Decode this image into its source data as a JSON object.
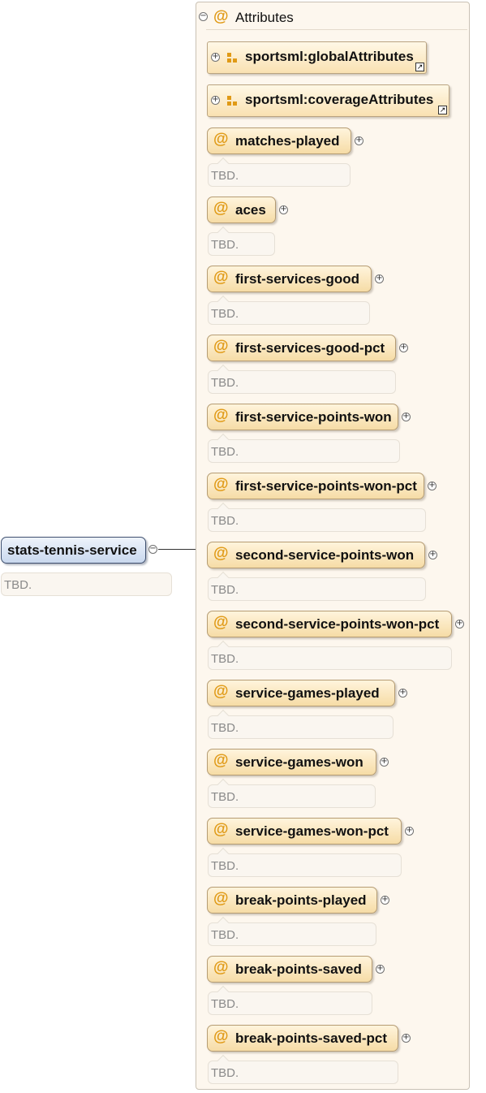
{
  "root": {
    "name": "stats-tennis-service",
    "doc": "TBD."
  },
  "attributes_panel": {
    "title": "Attributes",
    "groups": [
      {
        "label": "sportsml:globalAttributes"
      },
      {
        "label": "sportsml:coverageAttributes"
      }
    ],
    "items": [
      {
        "name": "matches-played",
        "doc": "TBD."
      },
      {
        "name": "aces",
        "doc": "TBD."
      },
      {
        "name": "first-services-good",
        "doc": "TBD."
      },
      {
        "name": "first-services-good-pct",
        "doc": "TBD."
      },
      {
        "name": "first-service-points-won",
        "doc": "TBD."
      },
      {
        "name": "first-service-points-won-pct",
        "doc": "TBD."
      },
      {
        "name": "second-service-points-won",
        "doc": "TBD."
      },
      {
        "name": "second-service-points-won-pct",
        "doc": "TBD."
      },
      {
        "name": "service-games-played",
        "doc": "TBD."
      },
      {
        "name": "service-games-won",
        "doc": "TBD."
      },
      {
        "name": "service-games-won-pct",
        "doc": "TBD."
      },
      {
        "name": "break-points-played",
        "doc": "TBD."
      },
      {
        "name": "break-points-saved",
        "doc": "TBD."
      },
      {
        "name": "break-points-saved-pct",
        "doc": "TBD."
      }
    ]
  },
  "symbols": {
    "attribute_icon": "@",
    "collapse": "−",
    "expand": "+",
    "link": "↗"
  },
  "colors": {
    "accent": "#e09a16",
    "attribute_fill": "#f6dca6",
    "root_fill": "#c9d8ee"
  }
}
